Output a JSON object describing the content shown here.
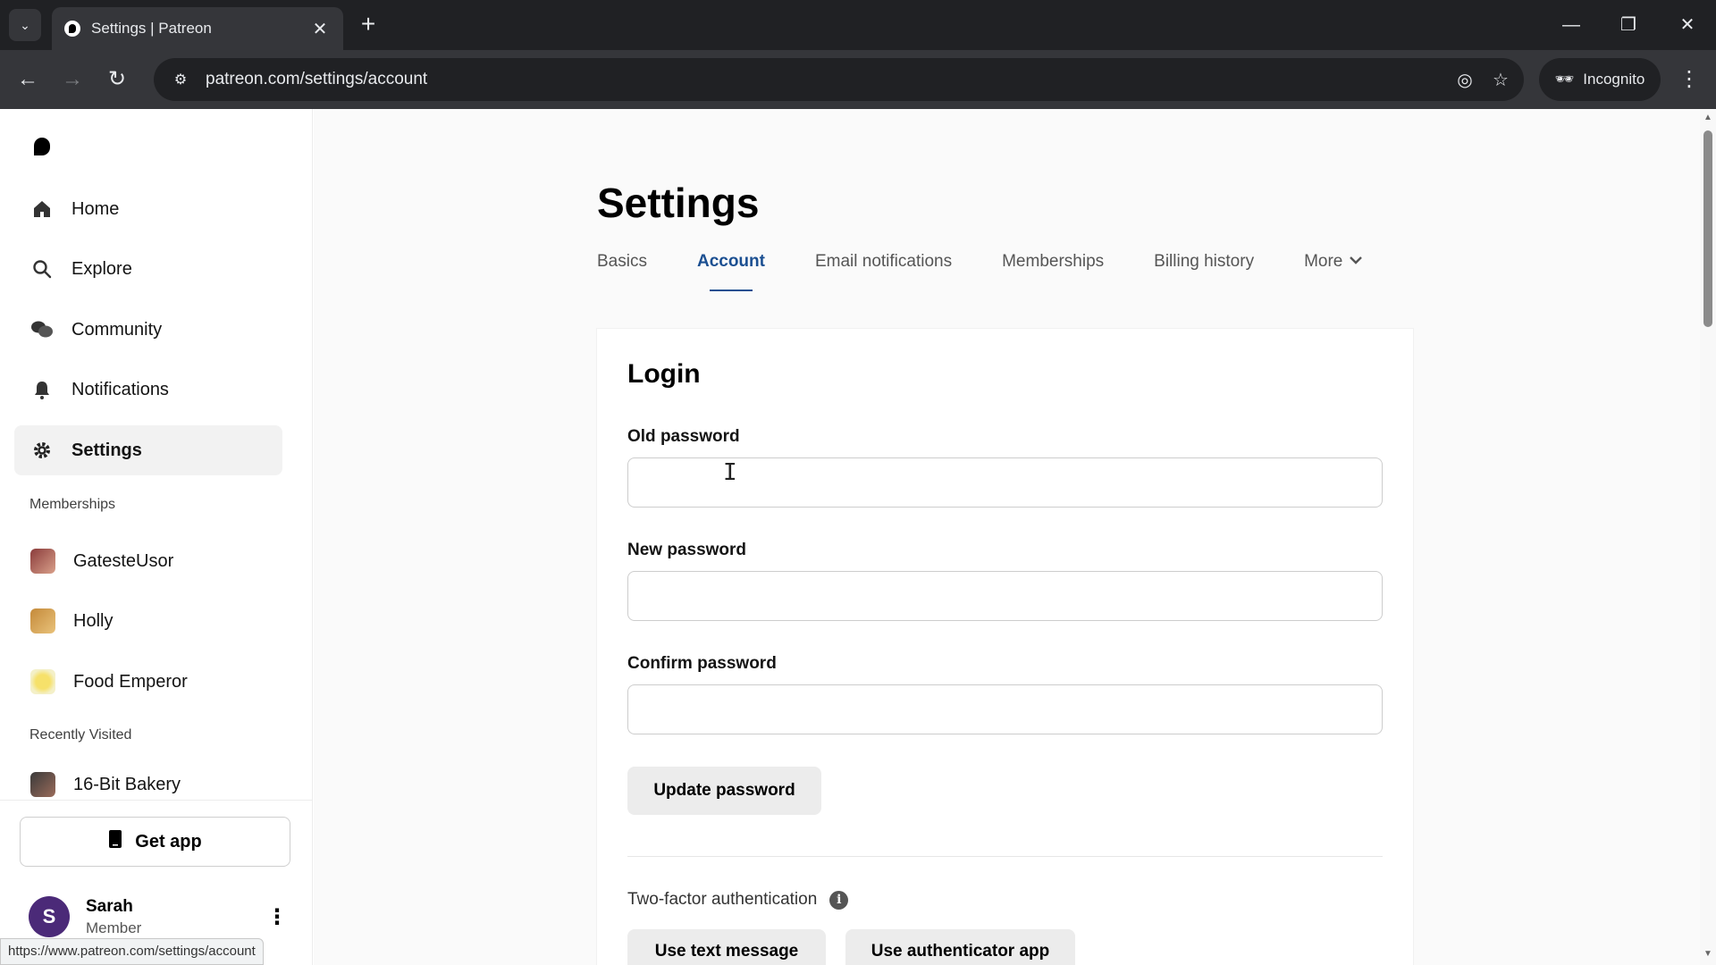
{
  "browser": {
    "tab_title": "Settings | Patreon",
    "url": "patreon.com/settings/account",
    "incognito_label": "Incognito",
    "status_url": "https://www.patreon.com/settings/account"
  },
  "sidebar": {
    "nav": [
      {
        "label": "Home",
        "icon": "home-icon"
      },
      {
        "label": "Explore",
        "icon": "search-icon"
      },
      {
        "label": "Community",
        "icon": "chat-icon"
      },
      {
        "label": "Notifications",
        "icon": "bell-icon"
      },
      {
        "label": "Settings",
        "icon": "gear-icon",
        "active": true
      }
    ],
    "memberships_heading": "Memberships",
    "memberships": [
      {
        "label": "GatesteUsor"
      },
      {
        "label": "Holly"
      },
      {
        "label": "Food Emperor"
      }
    ],
    "recent_heading": "Recently Visited",
    "recent": [
      {
        "label": "16-Bit Bakery"
      }
    ],
    "get_app_label": "Get app",
    "user": {
      "initial": "S",
      "name": "Sarah",
      "role": "Member"
    }
  },
  "main": {
    "title": "Settings",
    "tabs": [
      {
        "label": "Basics"
      },
      {
        "label": "Account",
        "active": true
      },
      {
        "label": "Email notifications"
      },
      {
        "label": "Memberships"
      },
      {
        "label": "Billing history"
      },
      {
        "label": "More"
      }
    ],
    "login": {
      "title": "Login",
      "old_password_label": "Old password",
      "old_password_value": "",
      "new_password_label": "New password",
      "new_password_value": "",
      "confirm_password_label": "Confirm password",
      "confirm_password_value": "",
      "update_button": "Update password"
    },
    "two_factor": {
      "label": "Two-factor authentication",
      "text_message_button": "Use text message",
      "authenticator_button": "Use authenticator app"
    }
  },
  "colors": {
    "accent": "#1b4f91",
    "user_avatar": "#4b2a78"
  }
}
